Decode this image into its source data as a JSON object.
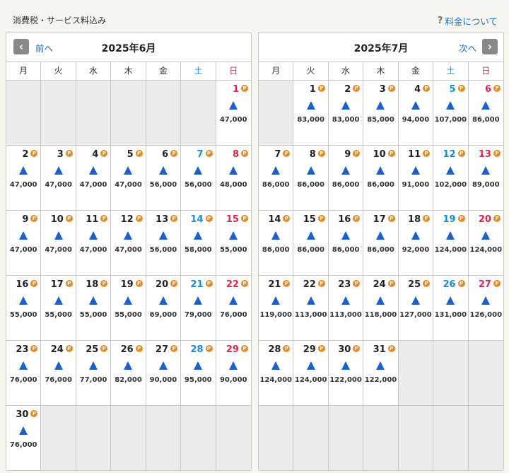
{
  "header": {
    "tax_note": "消費税・サービス料込み",
    "fee_link": "料金について"
  },
  "colors": {
    "saturday": "#1a8ad4",
    "sunday": "#d8264c",
    "available_mark": "#1e5fc8",
    "point_badge": "#e68a1f",
    "link": "#1a6fc4"
  },
  "weekdays": [
    "月",
    "火",
    "水",
    "木",
    "金",
    "土",
    "日"
  ],
  "calendars": [
    {
      "title": "2025年6月",
      "nav_label": "前へ",
      "nav_icon": "‹",
      "cells": [
        null,
        null,
        null,
        null,
        null,
        null,
        {
          "day": "1",
          "price": "47,000",
          "status": "▲"
        },
        {
          "day": "2",
          "price": "47,000",
          "status": "▲"
        },
        {
          "day": "3",
          "price": "47,000",
          "status": "▲"
        },
        {
          "day": "4",
          "price": "47,000",
          "status": "▲"
        },
        {
          "day": "5",
          "price": "47,000",
          "status": "▲"
        },
        {
          "day": "6",
          "price": "56,000",
          "status": "▲"
        },
        {
          "day": "7",
          "price": "56,000",
          "status": "▲"
        },
        {
          "day": "8",
          "price": "48,000",
          "status": "▲"
        },
        {
          "day": "9",
          "price": "47,000",
          "status": "▲"
        },
        {
          "day": "10",
          "price": "47,000",
          "status": "▲"
        },
        {
          "day": "11",
          "price": "47,000",
          "status": "▲"
        },
        {
          "day": "12",
          "price": "47,000",
          "status": "▲"
        },
        {
          "day": "13",
          "price": "56,000",
          "status": "▲"
        },
        {
          "day": "14",
          "price": "58,000",
          "status": "▲"
        },
        {
          "day": "15",
          "price": "55,000",
          "status": "▲"
        },
        {
          "day": "16",
          "price": "55,000",
          "status": "▲"
        },
        {
          "day": "17",
          "price": "55,000",
          "status": "▲"
        },
        {
          "day": "18",
          "price": "55,000",
          "status": "▲"
        },
        {
          "day": "19",
          "price": "55,000",
          "status": "▲"
        },
        {
          "day": "20",
          "price": "69,000",
          "status": "▲"
        },
        {
          "day": "21",
          "price": "79,000",
          "status": "▲"
        },
        {
          "day": "22",
          "price": "76,000",
          "status": "▲"
        },
        {
          "day": "23",
          "price": "76,000",
          "status": "▲"
        },
        {
          "day": "24",
          "price": "76,000",
          "status": "▲"
        },
        {
          "day": "25",
          "price": "77,000",
          "status": "▲"
        },
        {
          "day": "26",
          "price": "82,000",
          "status": "▲"
        },
        {
          "day": "27",
          "price": "90,000",
          "status": "▲"
        },
        {
          "day": "28",
          "price": "95,000",
          "status": "▲"
        },
        {
          "day": "29",
          "price": "90,000",
          "status": "▲"
        },
        {
          "day": "30",
          "price": "76,000",
          "status": "▲"
        },
        null,
        null,
        null,
        null,
        null,
        null
      ]
    },
    {
      "title": "2025年7月",
      "nav_label": "次へ",
      "nav_icon": "›",
      "cells": [
        null,
        {
          "day": "1",
          "price": "83,000",
          "status": "▲"
        },
        {
          "day": "2",
          "price": "83,000",
          "status": "▲"
        },
        {
          "day": "3",
          "price": "85,000",
          "status": "▲"
        },
        {
          "day": "4",
          "price": "94,000",
          "status": "▲"
        },
        {
          "day": "5",
          "price": "107,000",
          "status": "▲"
        },
        {
          "day": "6",
          "price": "86,000",
          "status": "▲"
        },
        {
          "day": "7",
          "price": "86,000",
          "status": "▲"
        },
        {
          "day": "8",
          "price": "86,000",
          "status": "▲"
        },
        {
          "day": "9",
          "price": "86,000",
          "status": "▲"
        },
        {
          "day": "10",
          "price": "86,000",
          "status": "▲"
        },
        {
          "day": "11",
          "price": "91,000",
          "status": "▲"
        },
        {
          "day": "12",
          "price": "102,000",
          "status": "▲"
        },
        {
          "day": "13",
          "price": "89,000",
          "status": "▲"
        },
        {
          "day": "14",
          "price": "86,000",
          "status": "▲"
        },
        {
          "day": "15",
          "price": "86,000",
          "status": "▲"
        },
        {
          "day": "16",
          "price": "86,000",
          "status": "▲"
        },
        {
          "day": "17",
          "price": "86,000",
          "status": "▲"
        },
        {
          "day": "18",
          "price": "92,000",
          "status": "▲"
        },
        {
          "day": "19",
          "price": "124,000",
          "status": "▲"
        },
        {
          "day": "20",
          "price": "124,000",
          "status": "▲"
        },
        {
          "day": "21",
          "price": "119,000",
          "status": "▲"
        },
        {
          "day": "22",
          "price": "113,000",
          "status": "▲"
        },
        {
          "day": "23",
          "price": "113,000",
          "status": "▲"
        },
        {
          "day": "24",
          "price": "118,000",
          "status": "▲"
        },
        {
          "day": "25",
          "price": "127,000",
          "status": "▲"
        },
        {
          "day": "26",
          "price": "131,000",
          "status": "▲"
        },
        {
          "day": "27",
          "price": "126,000",
          "status": "▲"
        },
        {
          "day": "28",
          "price": "124,000",
          "status": "▲"
        },
        {
          "day": "29",
          "price": "124,000",
          "status": "▲"
        },
        {
          "day": "30",
          "price": "122,000",
          "status": "▲"
        },
        {
          "day": "31",
          "price": "122,000",
          "status": "▲"
        },
        null,
        null,
        null,
        null,
        null,
        null,
        null,
        null,
        null,
        null
      ]
    }
  ]
}
